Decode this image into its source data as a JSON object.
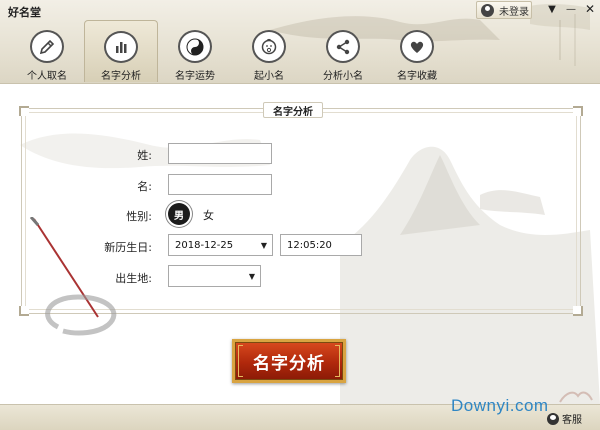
{
  "app": {
    "title": "好名堂"
  },
  "header": {
    "login_label": "未登录",
    "window_controls": {
      "menu": "▼",
      "minimize": "—",
      "close": "✕"
    }
  },
  "nav": {
    "items": [
      {
        "label": "个人取名",
        "icon": "pen-icon",
        "active": false
      },
      {
        "label": "名字分析",
        "icon": "bar-chart-icon",
        "active": true
      },
      {
        "label": "名字运势",
        "icon": "yin-yang-icon",
        "active": false
      },
      {
        "label": "起小名",
        "icon": "baby-icon",
        "active": false
      },
      {
        "label": "分析小名",
        "icon": "share-icon",
        "active": false
      },
      {
        "label": "名字收藏",
        "icon": "heart-icon",
        "active": false
      }
    ]
  },
  "form": {
    "section_title": "名字分析",
    "surname": {
      "label": "姓:",
      "value": ""
    },
    "given_name": {
      "label": "名:",
      "value": ""
    },
    "gender": {
      "label": "性别:",
      "male": "男",
      "female": "女",
      "selected": "男"
    },
    "birth": {
      "label": "新历生日:",
      "date": "2018-12-25",
      "time": "12:05:20"
    },
    "birthplace": {
      "label": "出生地:",
      "value": ""
    },
    "submit_label": "名字分析"
  },
  "status_bar": {
    "watermark": "Downyi.com",
    "service_label": "客服"
  },
  "colors": {
    "accent_red": "#b0280c",
    "gold": "#d9a441",
    "watermark_blue": "#2f86c4"
  }
}
